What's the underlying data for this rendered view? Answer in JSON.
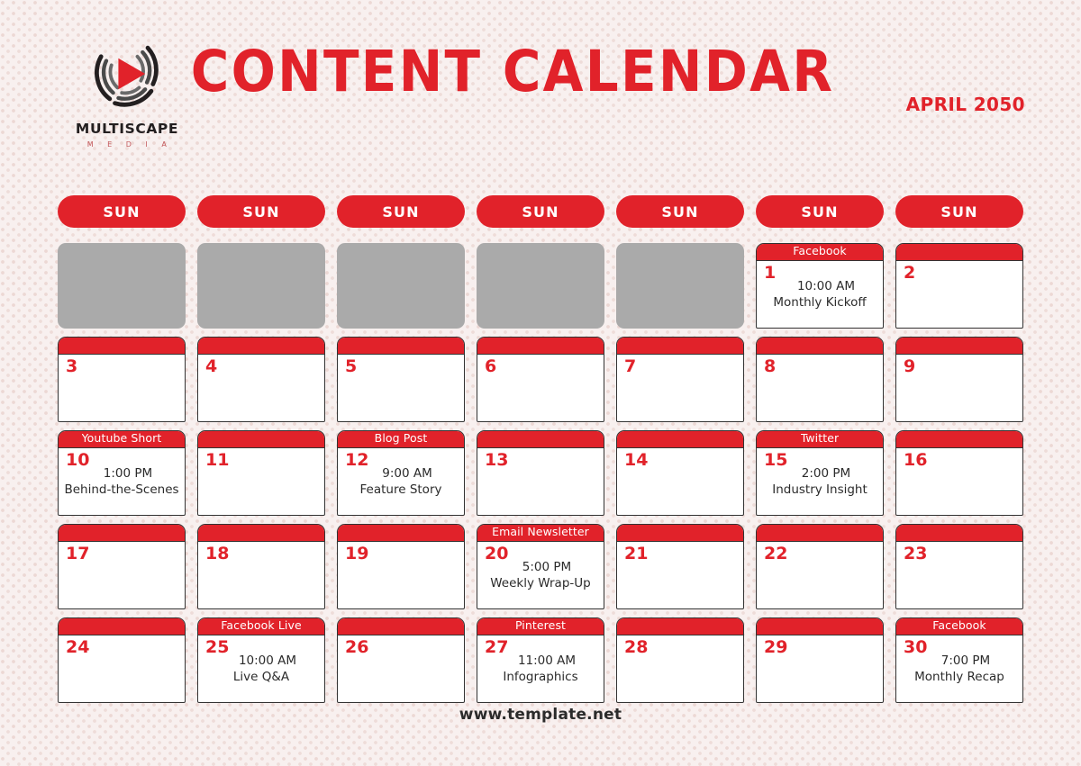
{
  "brand": {
    "logo_icon": "play-triangle-swirl-logo",
    "name": "MULTISCAPE",
    "tagline": "M E D I A"
  },
  "header": {
    "title": "CONTENT CALENDAR",
    "month": "APRIL 2050"
  },
  "colors": {
    "red": "#E1222A",
    "background": "#F8F0EF",
    "blank_cell": "#AAAAAA",
    "border": "#333333",
    "text": "#2B2B2B"
  },
  "day_headers": [
    "SUN",
    "SUN",
    "SUN",
    "SUN",
    "SUN",
    "SUN",
    "SUN"
  ],
  "weeks": [
    [
      {
        "type": "blank"
      },
      {
        "type": "blank"
      },
      {
        "type": "blank"
      },
      {
        "type": "blank"
      },
      {
        "type": "blank"
      },
      {
        "type": "day",
        "day": "1",
        "platform": "Facebook",
        "time": "10:00 AM",
        "title": "Monthly Kickoff"
      },
      {
        "type": "day",
        "day": "2",
        "platform": "",
        "time": "",
        "title": ""
      }
    ],
    [
      {
        "type": "day",
        "day": "3",
        "platform": "",
        "time": "",
        "title": ""
      },
      {
        "type": "day",
        "day": "4",
        "platform": "",
        "time": "",
        "title": ""
      },
      {
        "type": "day",
        "day": "5",
        "platform": "",
        "time": "",
        "title": ""
      },
      {
        "type": "day",
        "day": "6",
        "platform": "",
        "time": "",
        "title": ""
      },
      {
        "type": "day",
        "day": "7",
        "platform": "",
        "time": "",
        "title": ""
      },
      {
        "type": "day",
        "day": "8",
        "platform": "",
        "time": "",
        "title": ""
      },
      {
        "type": "day",
        "day": "9",
        "platform": "",
        "time": "",
        "title": ""
      }
    ],
    [
      {
        "type": "day",
        "day": "10",
        "platform": "Youtube Short",
        "time": "1:00 PM",
        "title": "Behind-the-Scenes"
      },
      {
        "type": "day",
        "day": "11",
        "platform": "",
        "time": "",
        "title": ""
      },
      {
        "type": "day",
        "day": "12",
        "platform": "Blog Post",
        "time": "9:00 AM",
        "title": "Feature Story"
      },
      {
        "type": "day",
        "day": "13",
        "platform": "",
        "time": "",
        "title": ""
      },
      {
        "type": "day",
        "day": "14",
        "platform": "",
        "time": "",
        "title": ""
      },
      {
        "type": "day",
        "day": "15",
        "platform": "Twitter",
        "time": "2:00 PM",
        "title": "Industry Insight"
      },
      {
        "type": "day",
        "day": "16",
        "platform": "",
        "time": "",
        "title": ""
      }
    ],
    [
      {
        "type": "day",
        "day": "17",
        "platform": "",
        "time": "",
        "title": ""
      },
      {
        "type": "day",
        "day": "18",
        "platform": "",
        "time": "",
        "title": ""
      },
      {
        "type": "day",
        "day": "19",
        "platform": "",
        "time": "",
        "title": ""
      },
      {
        "type": "day",
        "day": "20",
        "platform": "Email Newsletter",
        "time": "5:00 PM",
        "title": "Weekly Wrap-Up"
      },
      {
        "type": "day",
        "day": "21",
        "platform": "",
        "time": "",
        "title": ""
      },
      {
        "type": "day",
        "day": "22",
        "platform": "",
        "time": "",
        "title": ""
      },
      {
        "type": "day",
        "day": "23",
        "platform": "",
        "time": "",
        "title": ""
      }
    ],
    [
      {
        "type": "day",
        "day": "24",
        "platform": "",
        "time": "",
        "title": ""
      },
      {
        "type": "day",
        "day": "25",
        "platform": "Facebook Live",
        "time": "10:00 AM",
        "title": "Live Q&A"
      },
      {
        "type": "day",
        "day": "26",
        "platform": "",
        "time": "",
        "title": ""
      },
      {
        "type": "day",
        "day": "27",
        "platform": "Pinterest",
        "time": "11:00 AM",
        "title": "Infographics"
      },
      {
        "type": "day",
        "day": "28",
        "platform": "",
        "time": "",
        "title": ""
      },
      {
        "type": "day",
        "day": "29",
        "platform": "",
        "time": "",
        "title": ""
      },
      {
        "type": "day",
        "day": "30",
        "platform": "Facebook",
        "time": "7:00 PM",
        "title": "Monthly Recap"
      }
    ]
  ],
  "footer": {
    "url": "www.template.net"
  }
}
